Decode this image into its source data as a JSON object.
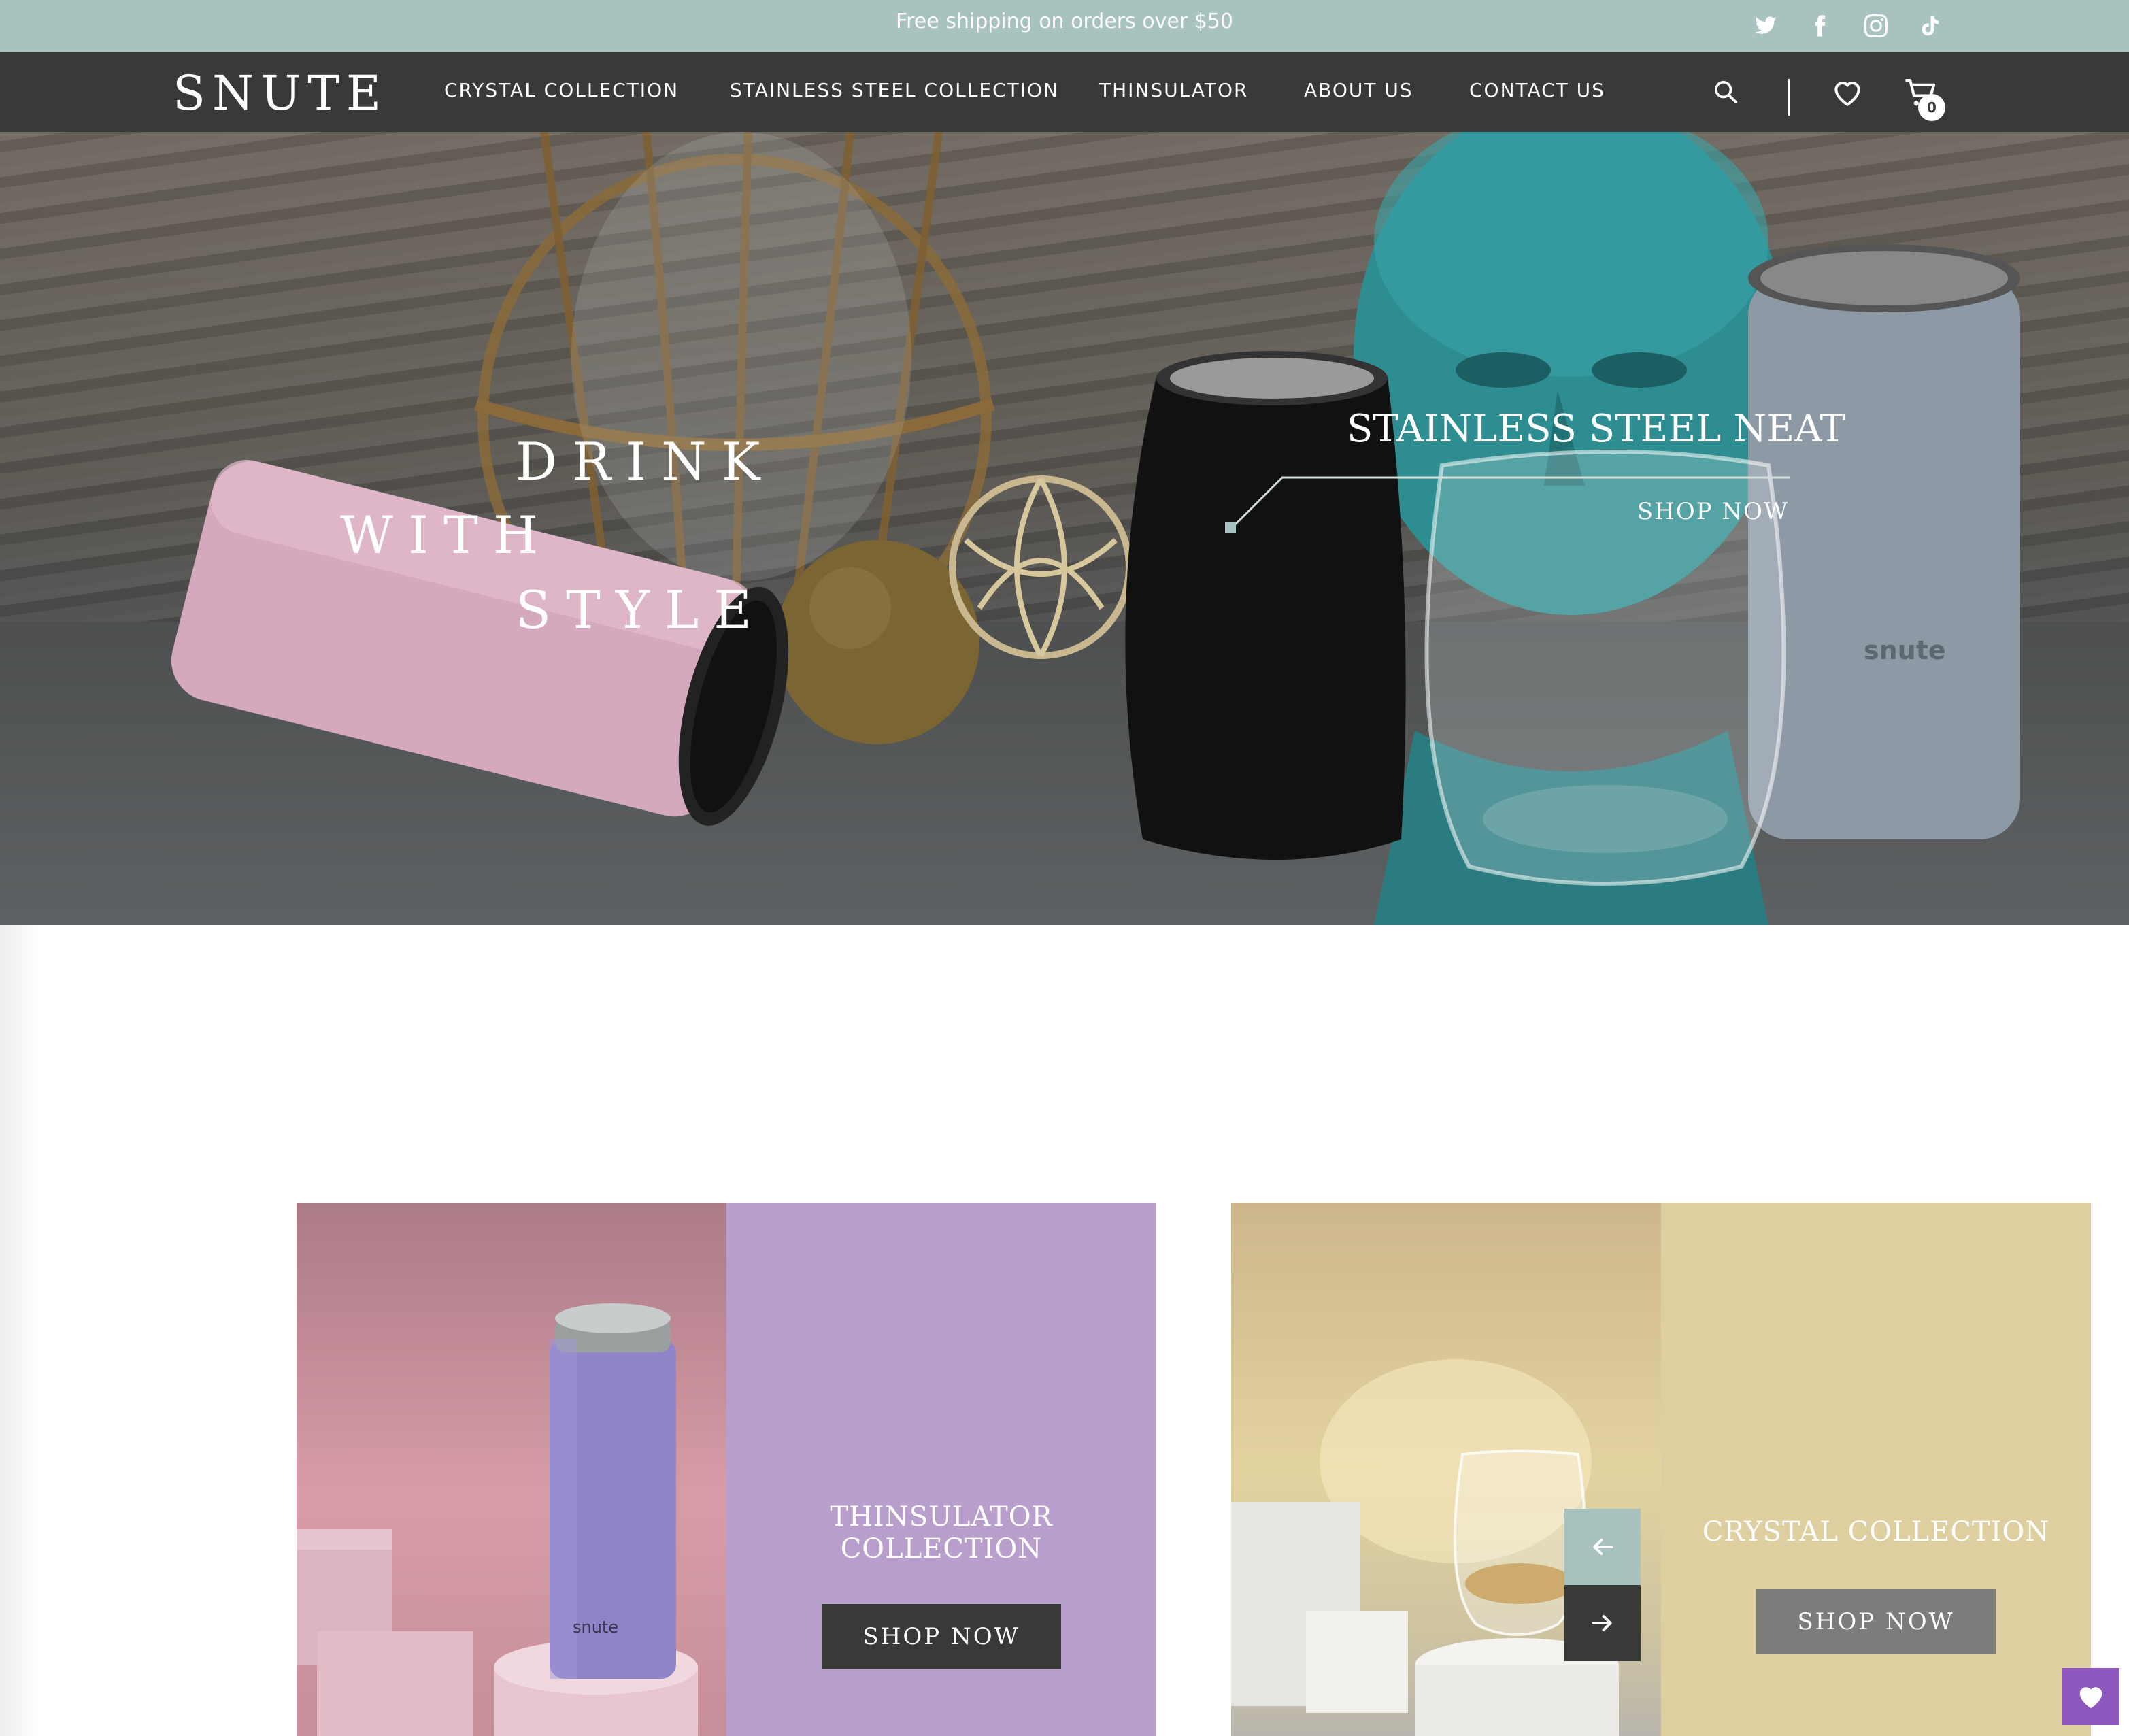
{
  "announcement": {
    "text": "Free shipping on orders over $50"
  },
  "social": [
    {
      "name": "twitter-icon"
    },
    {
      "name": "facebook-icon"
    },
    {
      "name": "instagram-icon"
    },
    {
      "name": "tiktok-icon"
    }
  ],
  "header": {
    "logo": "SNUTE",
    "nav": [
      "CRYSTAL COLLECTION",
      "STAINLESS STEEL COLLECTION",
      "THINSULATOR",
      "ABOUT US",
      "CONTACT US"
    ],
    "cart_count": "0"
  },
  "hero": {
    "headline": [
      "DRINK",
      "WITH",
      "STYLE"
    ],
    "product_title": "STAINLESS STEEL NEAT",
    "cta": "SHOP NOW",
    "tumbler_brand": "snute"
  },
  "promos": [
    {
      "title_line1": "THINSULATOR",
      "title_line2": "COLLECTION",
      "cta": "SHOP NOW",
      "can_brand": "snute"
    },
    {
      "title": "CRYSTAL COLLECTION",
      "cta": "SHOP NOW"
    }
  ],
  "colors": {
    "announcement_bg": "#a8c3bf",
    "nav_bg": "#383a37",
    "thinsulator_panel": "#b89ecb",
    "crystal_panel": "#ddcf9f",
    "wishlist_button": "#8e58bf"
  }
}
